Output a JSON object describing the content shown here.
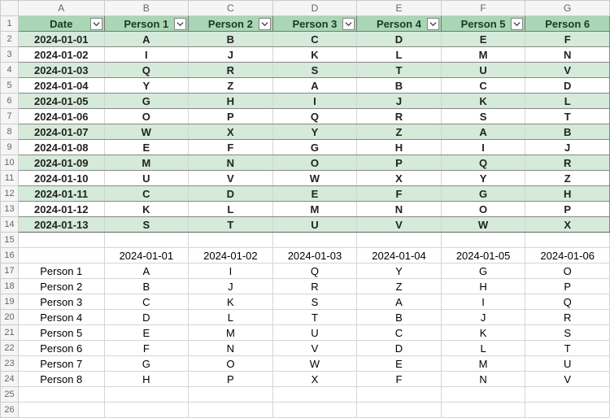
{
  "cols": [
    "A",
    "B",
    "C",
    "D",
    "E",
    "F",
    "G"
  ],
  "table1": {
    "headers": [
      "Date",
      "Person 1",
      "Person 2",
      "Person 3",
      "Person 4",
      "Person 5",
      "Person 6"
    ],
    "rows": [
      {
        "date": "2024-01-01",
        "v": [
          "A",
          "B",
          "C",
          "D",
          "E",
          "F"
        ]
      },
      {
        "date": "2024-01-02",
        "v": [
          "I",
          "J",
          "K",
          "L",
          "M",
          "N"
        ]
      },
      {
        "date": "2024-01-03",
        "v": [
          "Q",
          "R",
          "S",
          "T",
          "U",
          "V"
        ]
      },
      {
        "date": "2024-01-04",
        "v": [
          "Y",
          "Z",
          "A",
          "B",
          "C",
          "D"
        ]
      },
      {
        "date": "2024-01-05",
        "v": [
          "G",
          "H",
          "I",
          "J",
          "K",
          "L"
        ]
      },
      {
        "date": "2024-01-06",
        "v": [
          "O",
          "P",
          "Q",
          "R",
          "S",
          "T"
        ]
      },
      {
        "date": "2024-01-07",
        "v": [
          "W",
          "X",
          "Y",
          "Z",
          "A",
          "B"
        ]
      },
      {
        "date": "2024-01-08",
        "v": [
          "E",
          "F",
          "G",
          "H",
          "I",
          "J"
        ]
      },
      {
        "date": "2024-01-09",
        "v": [
          "M",
          "N",
          "O",
          "P",
          "Q",
          "R"
        ]
      },
      {
        "date": "2024-01-10",
        "v": [
          "U",
          "V",
          "W",
          "X",
          "Y",
          "Z"
        ]
      },
      {
        "date": "2024-01-11",
        "v": [
          "C",
          "D",
          "E",
          "F",
          "G",
          "H"
        ]
      },
      {
        "date": "2024-01-12",
        "v": [
          "K",
          "L",
          "M",
          "N",
          "O",
          "P"
        ]
      },
      {
        "date": "2024-01-13",
        "v": [
          "S",
          "T",
          "U",
          "V",
          "W",
          "X"
        ]
      }
    ]
  },
  "table2": {
    "dates": [
      "2024-01-01",
      "2024-01-02",
      "2024-01-03",
      "2024-01-04",
      "2024-01-05",
      "2024-01-06"
    ],
    "rows": [
      {
        "name": "Person 1",
        "v": [
          "A",
          "I",
          "Q",
          "Y",
          "G",
          "O"
        ]
      },
      {
        "name": "Person 2",
        "v": [
          "B",
          "J",
          "R",
          "Z",
          "H",
          "P"
        ]
      },
      {
        "name": "Person 3",
        "v": [
          "C",
          "K",
          "S",
          "A",
          "I",
          "Q"
        ]
      },
      {
        "name": "Person 4",
        "v": [
          "D",
          "L",
          "T",
          "B",
          "J",
          "R"
        ]
      },
      {
        "name": "Person 5",
        "v": [
          "E",
          "M",
          "U",
          "C",
          "K",
          "S"
        ]
      },
      {
        "name": "Person 6",
        "v": [
          "F",
          "N",
          "V",
          "D",
          "L",
          "T"
        ]
      },
      {
        "name": "Person 7",
        "v": [
          "G",
          "O",
          "W",
          "E",
          "M",
          "U"
        ]
      },
      {
        "name": "Person 8",
        "v": [
          "H",
          "P",
          "X",
          "F",
          "N",
          "V"
        ]
      }
    ]
  }
}
